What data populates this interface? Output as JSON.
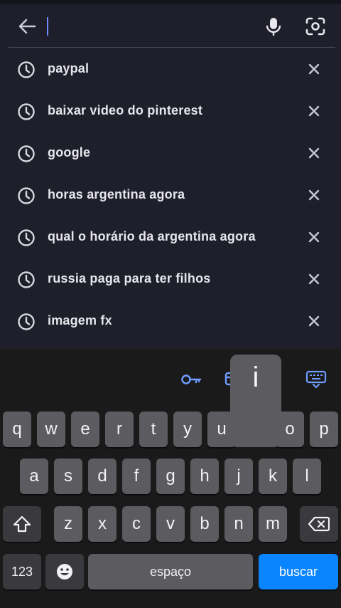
{
  "search": {
    "query": "",
    "back_icon": "arrow-left-icon",
    "mic_icon": "mic-icon",
    "lens_icon": "camera-lens-icon"
  },
  "history": [
    {
      "text": "paypal"
    },
    {
      "text": "baixar video do pinterest"
    },
    {
      "text": "google"
    },
    {
      "text": "horas argentina agora"
    },
    {
      "text": "qual o horário da argentina agora"
    },
    {
      "text": "russia paga para ter filhos"
    },
    {
      "text": "imagem fx"
    }
  ],
  "keyboard": {
    "toolbar_icons": [
      "key-icon",
      "card-icon",
      "keyboard-hide-icon"
    ],
    "row1": [
      "q",
      "w",
      "e",
      "r",
      "t",
      "y",
      "u",
      "i",
      "o",
      "p"
    ],
    "row2": [
      "a",
      "s",
      "d",
      "f",
      "g",
      "h",
      "j",
      "k",
      "l"
    ],
    "row3": [
      "z",
      "x",
      "c",
      "v",
      "b",
      "n",
      "m"
    ],
    "popup_letter": "i",
    "numbers_label": "123",
    "space_label": "espaço",
    "action_label": "buscar",
    "accent_color": "#0a84ff"
  }
}
